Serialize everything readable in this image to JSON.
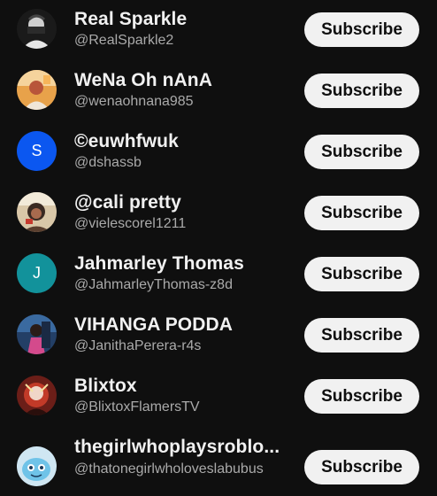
{
  "subscribe_label": "Subscribe",
  "channels": [
    {
      "name": "Real Sparkle",
      "handle": "@RealSparkle2",
      "avatar": {
        "type": "image",
        "icon": "profile-photo"
      }
    },
    {
      "name": "WeNa Oh nAnA",
      "handle": "@wenaohnana985",
      "avatar": {
        "type": "image",
        "icon": "profile-photo"
      }
    },
    {
      "name": "©euwhfwuk",
      "handle": "@dshassb",
      "avatar": {
        "type": "letter",
        "letter": "S",
        "color": "#0b57f0"
      }
    },
    {
      "name": "@cali pretty",
      "handle": "@vielescorel1211",
      "avatar": {
        "type": "image",
        "icon": "profile-photo"
      }
    },
    {
      "name": "Jahmarley Thomas",
      "handle": "@JahmarleyThomas-z8d",
      "avatar": {
        "type": "letter",
        "letter": "J",
        "color": "#12929b"
      }
    },
    {
      "name": "VIHANGA PODDA",
      "handle": "@JanithaPerera-r4s",
      "avatar": {
        "type": "image",
        "icon": "profile-photo"
      }
    },
    {
      "name": "Blixtox",
      "handle": "@BlixtoxFlamersTV",
      "avatar": {
        "type": "image",
        "icon": "profile-photo"
      }
    },
    {
      "name": "thegirlwhoplaysroblo...",
      "handle": "@thatonegirlwholoveslabubus",
      "avatar": {
        "type": "image",
        "icon": "profile-photo"
      }
    }
  ]
}
